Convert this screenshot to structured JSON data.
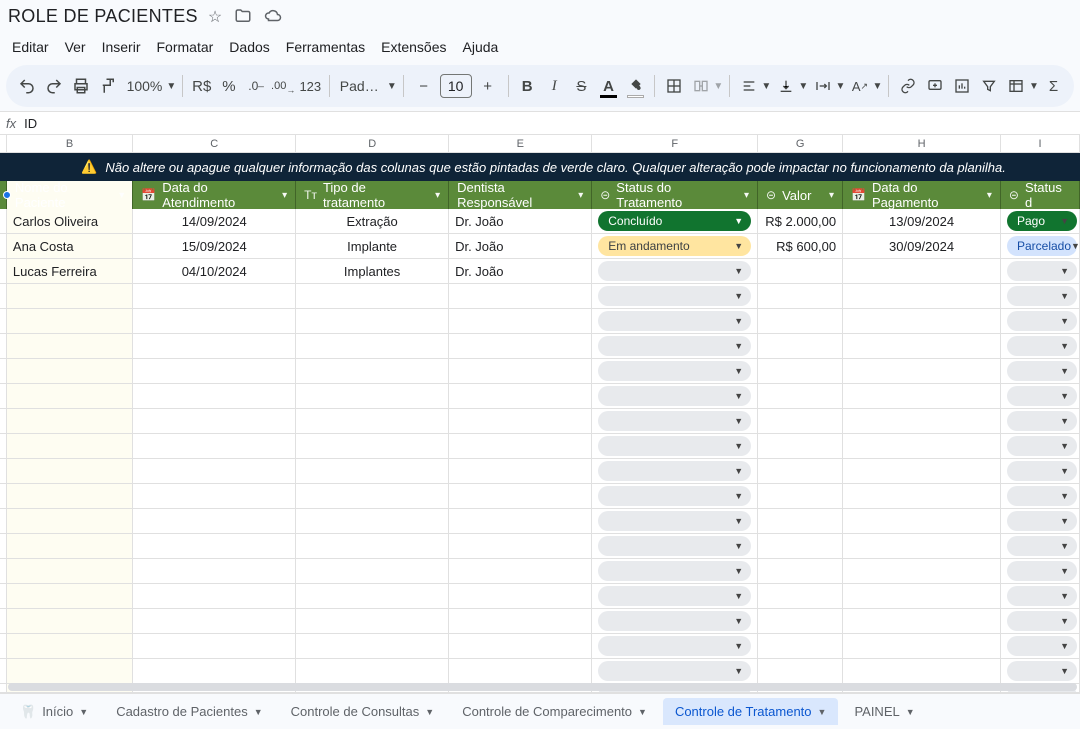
{
  "title": "ROLE DE PACIENTES",
  "menus": [
    "Editar",
    "Ver",
    "Inserir",
    "Formatar",
    "Dados",
    "Ferramentas",
    "Extensões",
    "Ajuda"
  ],
  "toolbar": {
    "zoom": "100%",
    "currency": "R$",
    "percent": "%",
    "dec_minus": ",0←",
    "dec_plus": ",00→",
    "numfmt": "123",
    "font": "Padrã…",
    "font_size": "10"
  },
  "formula": {
    "label": "ID"
  },
  "col_letters": [
    "B",
    "C",
    "D",
    "E",
    "F",
    "G",
    "H",
    "I"
  ],
  "warning": "Não altere ou apague qualquer informação das colunas que estão pintadas de verde claro. Qualquer alteração pode impactar no funcionamento da planilha.",
  "columns": {
    "B": "Nome do Paciente",
    "C": "Data do Atendimento",
    "D": "Tipo de tratamento",
    "E": "Dentista Responsável",
    "F": "Status do Tratamento",
    "G": "Valor",
    "H": "Data do Pagamento",
    "I": "Status d"
  },
  "rows": [
    {
      "nome": "Carlos Oliveira",
      "data_atend": "14/09/2024",
      "tipo": "Extração",
      "dentista": "Dr. João",
      "status": "Concluído",
      "status_class": "green",
      "valor": "R$ 2.000,00",
      "data_pag": "13/09/2024",
      "pag_status": "Pago",
      "pag_class": "darkgreen"
    },
    {
      "nome": "Ana Costa",
      "data_atend": "15/09/2024",
      "tipo": "Implante",
      "dentista": "Dr. João",
      "status": "Em andamento",
      "status_class": "yellow",
      "valor": "R$ 600,00",
      "data_pag": "30/09/2024",
      "pag_status": "Parcelado",
      "pag_class": "blue"
    },
    {
      "nome": "Lucas Ferreira",
      "data_atend": "04/10/2024",
      "tipo": "Implantes",
      "dentista": "Dr. João",
      "status": "",
      "status_class": "grey",
      "valor": "",
      "data_pag": "",
      "pag_status": "",
      "pag_class": "grey"
    }
  ],
  "empty_rows": 18,
  "tabs": [
    {
      "label": "Início",
      "icon": "🦷",
      "active": false
    },
    {
      "label": "Cadastro de Pacientes",
      "active": false
    },
    {
      "label": "Controle de Consultas",
      "active": false
    },
    {
      "label": "Controle de Comparecimento",
      "active": false
    },
    {
      "label": "Controle de Tratamento",
      "active": true
    },
    {
      "label": "PAINEL",
      "active": false
    }
  ]
}
